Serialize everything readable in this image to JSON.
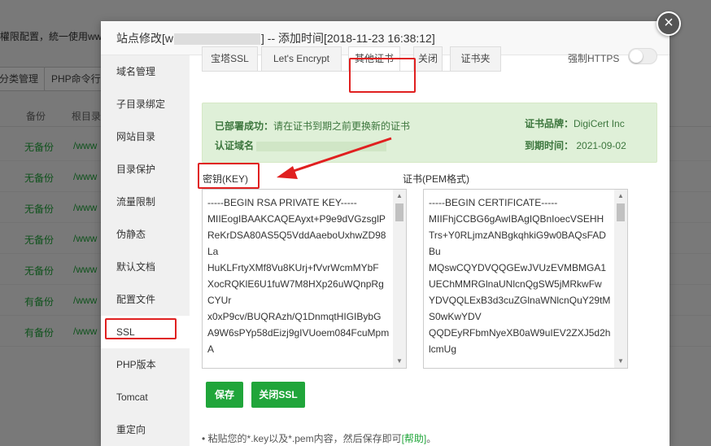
{
  "background": {
    "notice": "權限配置，統一使用ww",
    "buttons": [
      "分类管理",
      "PHP命令行"
    ],
    "columns": [
      "备份",
      "根目录"
    ],
    "rows": [
      {
        "backup": "无备份",
        "root": "/www"
      },
      {
        "backup": "无备份",
        "root": "/www"
      },
      {
        "backup": "无备份",
        "root": "/www"
      },
      {
        "backup": "无备份",
        "root": "/www"
      },
      {
        "backup": "无备份",
        "root": "/www"
      },
      {
        "backup": "有备份",
        "root": "/www"
      },
      {
        "backup": "有备份",
        "root": "/www"
      }
    ]
  },
  "modal": {
    "title_prefix": "站点修改[w",
    "title_suffix": "] -- 添加时间[2018-11-23 16:38:12]",
    "close_icon": "×"
  },
  "sidebar": {
    "items": [
      "域名管理",
      "子目录绑定",
      "网站目录",
      "目录保护",
      "流量限制",
      "伪静态",
      "默认文档",
      "配置文件",
      "SSL",
      "PHP版本",
      "Tomcat",
      "重定向"
    ],
    "active": "SSL"
  },
  "tabs": {
    "items": [
      "宝塔SSL",
      "Let's Encrypt",
      "其他证书",
      "关闭",
      "证书夹"
    ],
    "active": "其他证书"
  },
  "https": {
    "label": "强制HTTPS",
    "enabled": false
  },
  "status": {
    "deployed_label": "已部署成功：",
    "deployed_text": "请在证书到期之前更换新的证书",
    "domain_label": "认证域名",
    "brand_label": "证书品牌：",
    "brand_value": "DigiCert Inc",
    "expire_label": "到期时间：",
    "expire_value": "2021-09-02"
  },
  "key_field": {
    "label": "密钥(KEY)",
    "value": "-----BEGIN RSA PRIVATE KEY-----\nMIIEogIBAAKCAQEAyxt+P9e9dVGzsglP\nReKrDSA80AS5Q5VddAaeboUxhwZD98La\nHuKLFrtyXMf8Vu8KUrj+fVvrWcmMYbF\nXocRQKlE6U1fuW7M8HXp26uWQnpRgCYUr\nx0xP9cv/BUQRAzh/Q1DnmqtHIGIBybG\nA9W6sPYp58dEizj9gIVUoem084FcuMpmA"
  },
  "cert_field": {
    "label": "证书(PEM格式)",
    "value": "-----BEGIN CERTIFICATE-----\nMIIFhjCCBG6gAwIBAgIQBnIoecVSEHH\nTrs+Y0RLjmzANBgkqhkiG9w0BAQsFADBu\nMQswCQYDVQQGEwJVUzEVMBMGA1\nUEChMMRGlnaUNlcnQgSW5jMRkwFw\nYDVQQLExB3d3cuZGlnaWNlcnQuY29tMS0wKwYDV\nQQDEyRFbmNyeXB0aW9uIEV2ZXJ5d2hlcmUg"
  },
  "buttons": {
    "save": "保存",
    "close_ssl": "关闭SSL"
  },
  "tip": {
    "text": "粘贴您的*.key以及*.pem内容，然后保存即可",
    "link": "[帮助]",
    "end": "。"
  },
  "colors": {
    "accent": "#20a53a",
    "annotation": "#e02020"
  }
}
